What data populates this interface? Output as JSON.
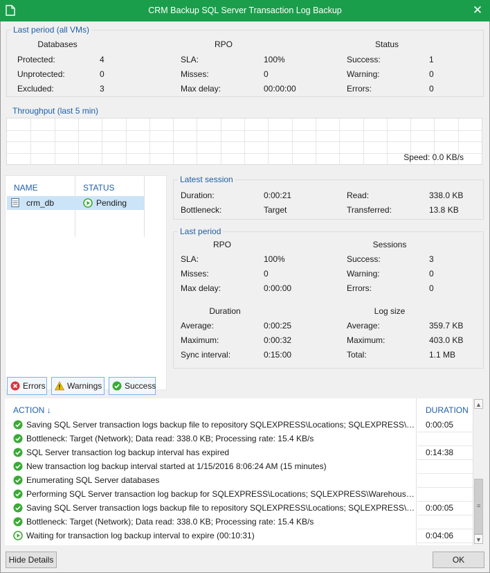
{
  "window": {
    "title": "CRM Backup SQL Server Transaction Log Backup",
    "close_glyph": "✕"
  },
  "last_period_all": {
    "title": "Last period (all VMs)",
    "databases": {
      "header": "Databases",
      "rows": [
        {
          "label": "Protected:",
          "value": "4"
        },
        {
          "label": "Unprotected:",
          "value": "0"
        },
        {
          "label": "Excluded:",
          "value": "3"
        }
      ]
    },
    "rpo": {
      "header": "RPO",
      "rows": [
        {
          "label": "SLA:",
          "value": "100%"
        },
        {
          "label": "Misses:",
          "value": "0"
        },
        {
          "label": "Max delay:",
          "value": "00:00:00"
        }
      ]
    },
    "status": {
      "header": "Status",
      "rows": [
        {
          "label": "Success:",
          "value": "1"
        },
        {
          "label": "Warning:",
          "value": "0"
        },
        {
          "label": "Errors:",
          "value": "0"
        }
      ]
    }
  },
  "throughput": {
    "title": "Throughput (last 5 min)",
    "speed": "Speed: 0.0 KB/s"
  },
  "vm_list": {
    "headers": {
      "name": "NAME",
      "status": "STATUS"
    },
    "rows": [
      {
        "name": "crm_db",
        "status": "Pending"
      }
    ]
  },
  "latest_session": {
    "title": "Latest session",
    "rows_left": [
      {
        "label": "Duration:",
        "value": "0:00:21"
      },
      {
        "label": "Bottleneck:",
        "value": "Target"
      }
    ],
    "rows_right": [
      {
        "label": "Read:",
        "value": "338.0 KB"
      },
      {
        "label": "Transferred:",
        "value": "13.8 KB"
      }
    ]
  },
  "last_period": {
    "title": "Last period",
    "rpo": {
      "header": "RPO",
      "rows": [
        {
          "label": "SLA:",
          "value": "100%"
        },
        {
          "label": "Misses:",
          "value": "0"
        },
        {
          "label": "Max delay:",
          "value": "0:00:00"
        }
      ]
    },
    "sessions": {
      "header": "Sessions",
      "rows": [
        {
          "label": "Success:",
          "value": "3"
        },
        {
          "label": "Warning:",
          "value": "0"
        },
        {
          "label": "Errors:",
          "value": "0"
        }
      ]
    },
    "duration": {
      "header": "Duration",
      "rows": [
        {
          "label": "Average:",
          "value": "0:00:25"
        },
        {
          "label": "Maximum:",
          "value": "0:00:32"
        },
        {
          "label": "Sync interval:",
          "value": "0:15:00"
        }
      ]
    },
    "log_size": {
      "header": "Log size",
      "rows": [
        {
          "label": "Average:",
          "value": "359.7 KB"
        },
        {
          "label": "Maximum:",
          "value": "403.0 KB"
        },
        {
          "label": "Total:",
          "value": "1.1 MB"
        }
      ]
    }
  },
  "filters": {
    "errors": "Errors",
    "warnings": "Warnings",
    "success": "Success"
  },
  "log": {
    "headers": {
      "action": "ACTION",
      "sort_glyph": "↓",
      "duration": "DURATION"
    },
    "rows": [
      {
        "icon": "success",
        "message": "Saving SQL Server transaction logs backup file to repository SQLEXPRESS\\Locations; SQLEXPRESS\\Wa...",
        "duration": "0:00:05"
      },
      {
        "icon": "success",
        "message": "Bottleneck: Target (Network); Data read: 338.0 KB; Processing rate: 15.4 KB/s",
        "duration": ""
      },
      {
        "icon": "success",
        "message": "SQL Server transaction log backup interval has expired",
        "duration": "0:14:38"
      },
      {
        "icon": "success",
        "message": "New transaction log backup interval started at 1/15/2016 8:06:24 AM (15 minutes)",
        "duration": ""
      },
      {
        "icon": "success",
        "message": "Enumerating SQL Server databases",
        "duration": ""
      },
      {
        "icon": "success",
        "message": "Performing SQL Server transaction log backup for SQLEXPRESS\\Locations; SQLEXPRESS\\Warehouse; S...",
        "duration": ""
      },
      {
        "icon": "success",
        "message": "Saving SQL Server transaction logs backup file to repository SQLEXPRESS\\Locations; SQLEXPRESS\\Wa...",
        "duration": "0:00:05"
      },
      {
        "icon": "success",
        "message": "Bottleneck: Target (Network); Data read: 338.0 KB; Processing rate: 15.4 KB/s",
        "duration": ""
      },
      {
        "icon": "running",
        "message": "Waiting for transaction log backup interval to expire (00:10:31)",
        "duration": "0:04:06"
      }
    ]
  },
  "buttons": {
    "hide_details": "Hide Details",
    "ok": "OK"
  },
  "colors": {
    "titlebar": "#1b9e4b",
    "accent_blue": "#1f5fa8",
    "success_green": "#3aaa35",
    "error_red": "#d9363e",
    "warning_yellow": "#f2c200"
  }
}
